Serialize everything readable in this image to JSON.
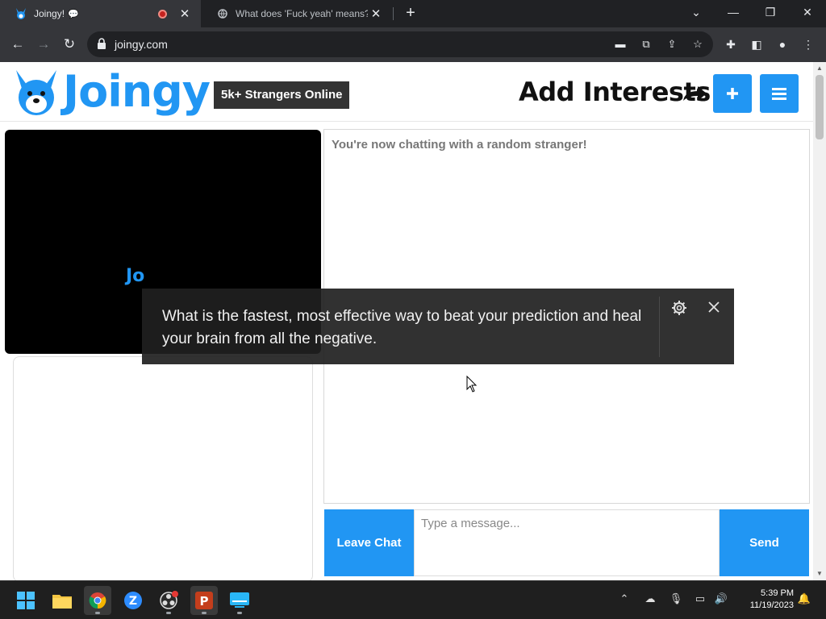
{
  "browser": {
    "tabs": [
      {
        "title": "Joingy!",
        "active": true
      },
      {
        "title": "What does 'Fuck yeah' means? -",
        "active": false
      }
    ],
    "url": "joingy.com"
  },
  "header": {
    "logo_text": "Joingy",
    "online_badge": "5k+ Strangers Online",
    "add_interests": "Add Interests"
  },
  "chat": {
    "system_message": "You're now chatting with a random stranger!",
    "leave_label": "Leave Chat",
    "input_placeholder": "Type a message...",
    "send_label": "Send"
  },
  "caption": {
    "text": "What is the fastest, most effective way to beat your prediction and heal your brain from all the negative.",
    "partial_logo": "Jo"
  },
  "taskbar": {
    "time": "5:39 PM",
    "date": "11/19/2023"
  },
  "colors": {
    "brand_blue": "#2196f3",
    "chrome_dark": "#202124",
    "chrome_toolbar": "#35363a"
  }
}
